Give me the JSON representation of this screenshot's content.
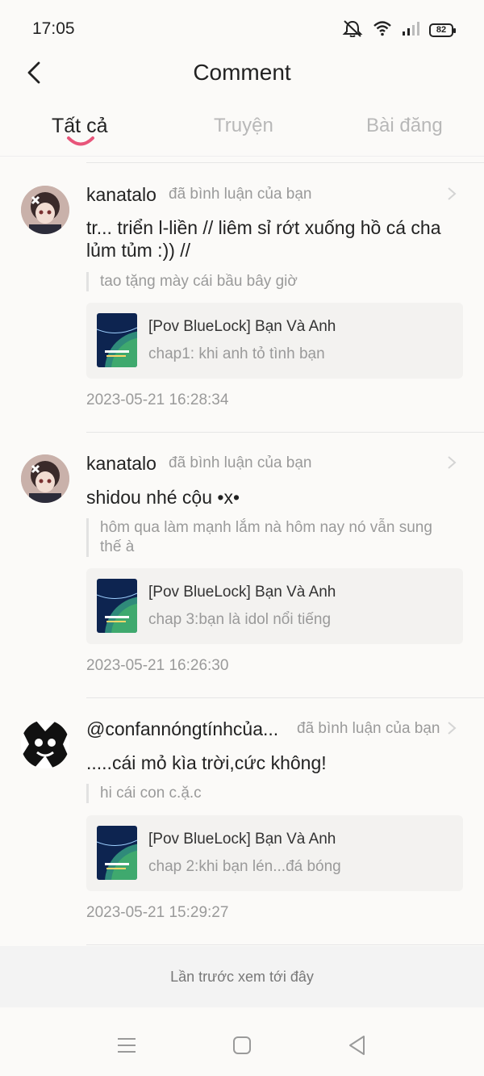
{
  "status": {
    "time": "17:05",
    "battery": "82",
    "icons": [
      "mute-icon",
      "wifi-icon",
      "signal-icon",
      "battery-icon"
    ]
  },
  "header": {
    "title": "Comment",
    "back_icon": "back-arrow-icon"
  },
  "tabs": [
    {
      "label": "Tất cả",
      "active": true
    },
    {
      "label": "Truyện",
      "active": false
    },
    {
      "label": "Bài đăng",
      "active": false
    }
  ],
  "colors": {
    "tab_indicator": "#e8557a",
    "text_primary": "#222222",
    "text_secondary": "#9a9a9a"
  },
  "items": [
    {
      "username": "kanatalo",
      "action": "đã bình luận của bạn",
      "comment": "tr... triển l-liền // liêm sỉ rớt xuống hồ cá cha lủm tủm :)) //",
      "quote": "tao tặng mày cái bầu bây giờ",
      "story_title": "[Pov BlueLock] Bạn Và Anh",
      "chapter": "chap1: khi anh tỏ tình bạn",
      "timestamp": "2023-05-21 16:28:34"
    },
    {
      "username": "kanatalo",
      "action": "đã bình luận của bạn",
      "comment": "shidou nhé cộu •x•",
      "quote": "hôm qua làm mạnh lắm nà hôm nay nó vẫn sung thế à",
      "story_title": "[Pov BlueLock] Bạn Và Anh",
      "chapter": "chap 3:bạn là idol nổi tiếng",
      "timestamp": "2023-05-21 16:26:30"
    },
    {
      "username": "@confannóngtínhcủa...",
      "action": "đã bình luận của bạn",
      "comment": ".....cái mỏ kìa trời,cức không!",
      "quote": "hi cái con c.ặ.c",
      "story_title": "[Pov BlueLock] Bạn Và Anh",
      "chapter": "chap 2:khi bạn lén...đá bóng",
      "timestamp": "2023-05-21 15:29:27"
    }
  ],
  "last_seen": "Lần trước xem tới đây",
  "nav": [
    "menu-icon",
    "home-icon",
    "back-triangle-icon"
  ]
}
